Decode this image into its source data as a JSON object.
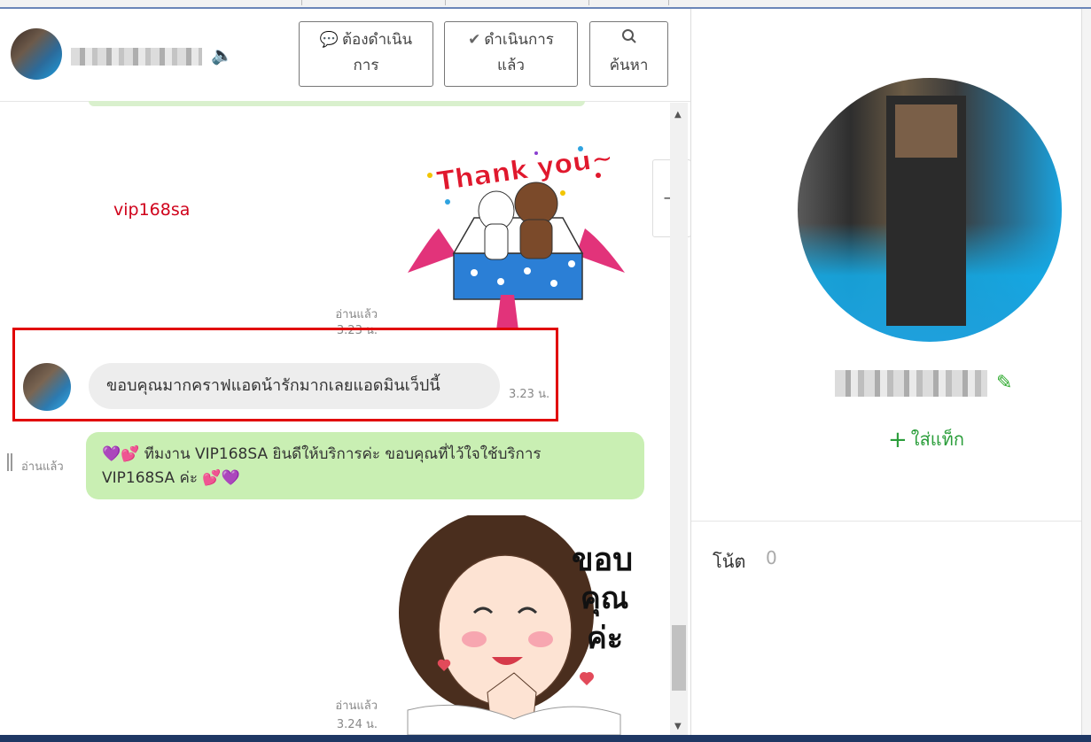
{
  "chat": {
    "buttons": {
      "pending_l1": "ต้องดำเนิน",
      "pending_l2": "การ",
      "done_l1": "ดำเนินการ",
      "done_l2": "แล้ว",
      "search_label": "ค้นหา"
    },
    "watermark": "vip168sa",
    "messages": {
      "read1": "อ่านแล้ว",
      "time1": "3.23 น.",
      "incoming_text": "ขอบคุณมากคราฟแอดน้ารักมากเลยแอดมินเว็ปนี้",
      "incoming_time": "3.23 น.",
      "read2": "อ่านแล้ว",
      "outgoing_line1": "💜💕 ทีมงาน VIP168SA ยินดีให้บริการค่ะ ขอบคุณที่ไว้ใจใช้บริการ",
      "outgoing_line2": "VIP168SA ค่ะ 💕💜",
      "read3": "อ่านแล้ว",
      "time3": "3.24 น."
    },
    "stickers": {
      "thank_you_text": "Thank you~",
      "khob_khun_text": "ขอบ คุณ ค่ะ"
    }
  },
  "profile": {
    "add_tag_label": "ใส่แท็ก",
    "note_label": "โน้ต",
    "note_count": "0"
  },
  "colors": {
    "accent_green": "#2a9d3a",
    "highlight_red": "#e10000",
    "outgoing_bubble": "#c9efb3"
  },
  "icons": [
    "chat-bubble-icon",
    "check-bubble-icon",
    "search-icon",
    "speaker-icon",
    "collapse-panel-icon",
    "pencil-icon",
    "plus-icon"
  ]
}
